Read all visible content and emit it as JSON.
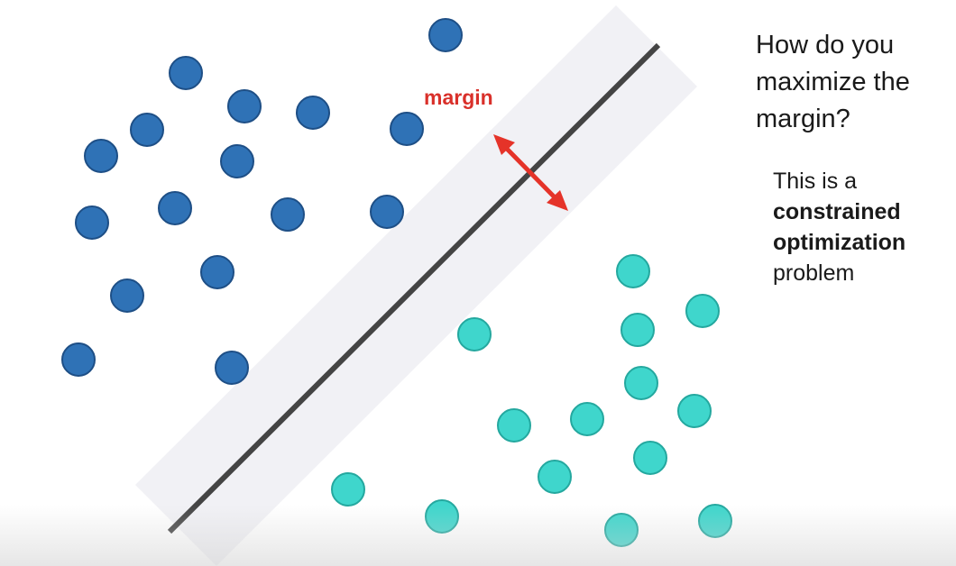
{
  "diagram": {
    "margin_label": "margin",
    "colors": {
      "class_a_fill": "#2f72b6",
      "class_a_stroke": "#1e4f86",
      "class_b_fill": "#3fd6cc",
      "class_b_stroke": "#24a89f",
      "boundary": "#444444",
      "margin_band": "#f1f1f5",
      "margin_arrow": "#e53329",
      "margin_label": "#d9302a"
    }
  },
  "text": {
    "question": "How do you maximize the margin?",
    "explanation_line1": "This is a",
    "explanation_bold1": "constrained",
    "explanation_bold2": "optimization",
    "explanation_line4": "problem"
  }
}
